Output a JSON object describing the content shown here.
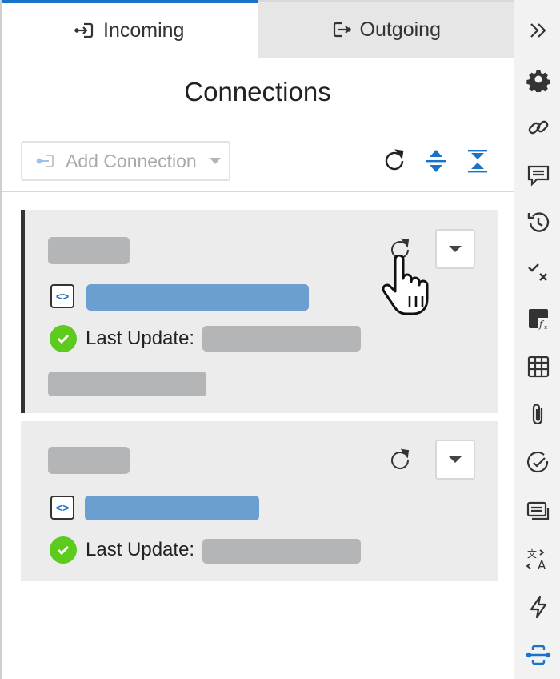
{
  "tabs": [
    {
      "label": "Incoming",
      "active": true
    },
    {
      "label": "Outgoing",
      "active": false
    }
  ],
  "page_title": "Connections",
  "toolbar": {
    "add_connection_label": "Add Connection"
  },
  "cards": [
    {
      "last_update_label": "Last Update:"
    },
    {
      "last_update_label": "Last Update:"
    }
  ],
  "colors": {
    "accent": "#1a73c9",
    "success": "#5ccb1e",
    "placeholder_gray": "#b3b5b7",
    "placeholder_blue": "#6a9fd0"
  },
  "sidebar_icons": [
    "expand-icon",
    "gear-icon",
    "link-icon",
    "comment-icon",
    "history-icon",
    "checks-icon",
    "formula-icon",
    "table-icon",
    "attachment-icon",
    "approval-icon",
    "forms-icon",
    "translate-icon",
    "automation-icon",
    "connections-icon"
  ]
}
